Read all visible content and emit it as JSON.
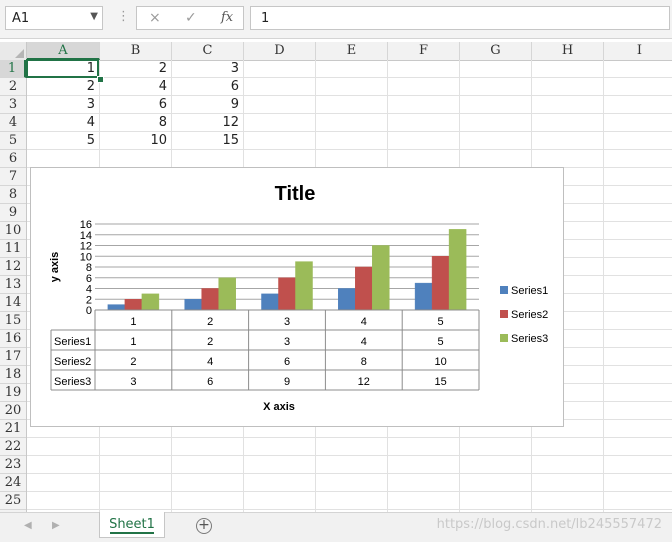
{
  "formula_bar": {
    "name_box": "A1",
    "cancel_icon": "×",
    "enter_icon": "✓",
    "fx_label": "fx",
    "formula_value": "1"
  },
  "columns": [
    "A",
    "B",
    "C",
    "D",
    "E",
    "F",
    "G",
    "H",
    "I"
  ],
  "rows": [
    "1",
    "2",
    "3",
    "4",
    "5",
    "6",
    "7",
    "8",
    "9",
    "10",
    "11",
    "12",
    "13",
    "14",
    "15",
    "16",
    "17",
    "18",
    "19",
    "20",
    "21",
    "22",
    "23",
    "24",
    "25"
  ],
  "selected_cell": "A1",
  "cells": [
    [
      "1",
      "2",
      "3"
    ],
    [
      "2",
      "4",
      "6"
    ],
    [
      "3",
      "6",
      "9"
    ],
    [
      "4",
      "8",
      "12"
    ],
    [
      "5",
      "10",
      "15"
    ]
  ],
  "chart_data": {
    "type": "bar",
    "title": "Title",
    "xlabel": "X axis",
    "ylabel": "y axis",
    "categories": [
      "1",
      "2",
      "3",
      "4",
      "5"
    ],
    "ylim": [
      0,
      16
    ],
    "yticks": [
      0,
      2,
      4,
      6,
      8,
      10,
      12,
      14,
      16
    ],
    "grid": true,
    "legend": "right",
    "data_table": true,
    "series": [
      {
        "name": "Series1",
        "values": [
          1,
          2,
          3,
          4,
          5
        ],
        "color": "#4f81bd"
      },
      {
        "name": "Series2",
        "values": [
          2,
          4,
          6,
          8,
          10
        ],
        "color": "#c0504d"
      },
      {
        "name": "Series3",
        "values": [
          3,
          6,
          9,
          12,
          15
        ],
        "color": "#9bbb59"
      }
    ]
  },
  "sheets": [
    "Sheet1"
  ],
  "watermark": "https://blog.csdn.net/lb245557472",
  "accent_color": "#217346"
}
